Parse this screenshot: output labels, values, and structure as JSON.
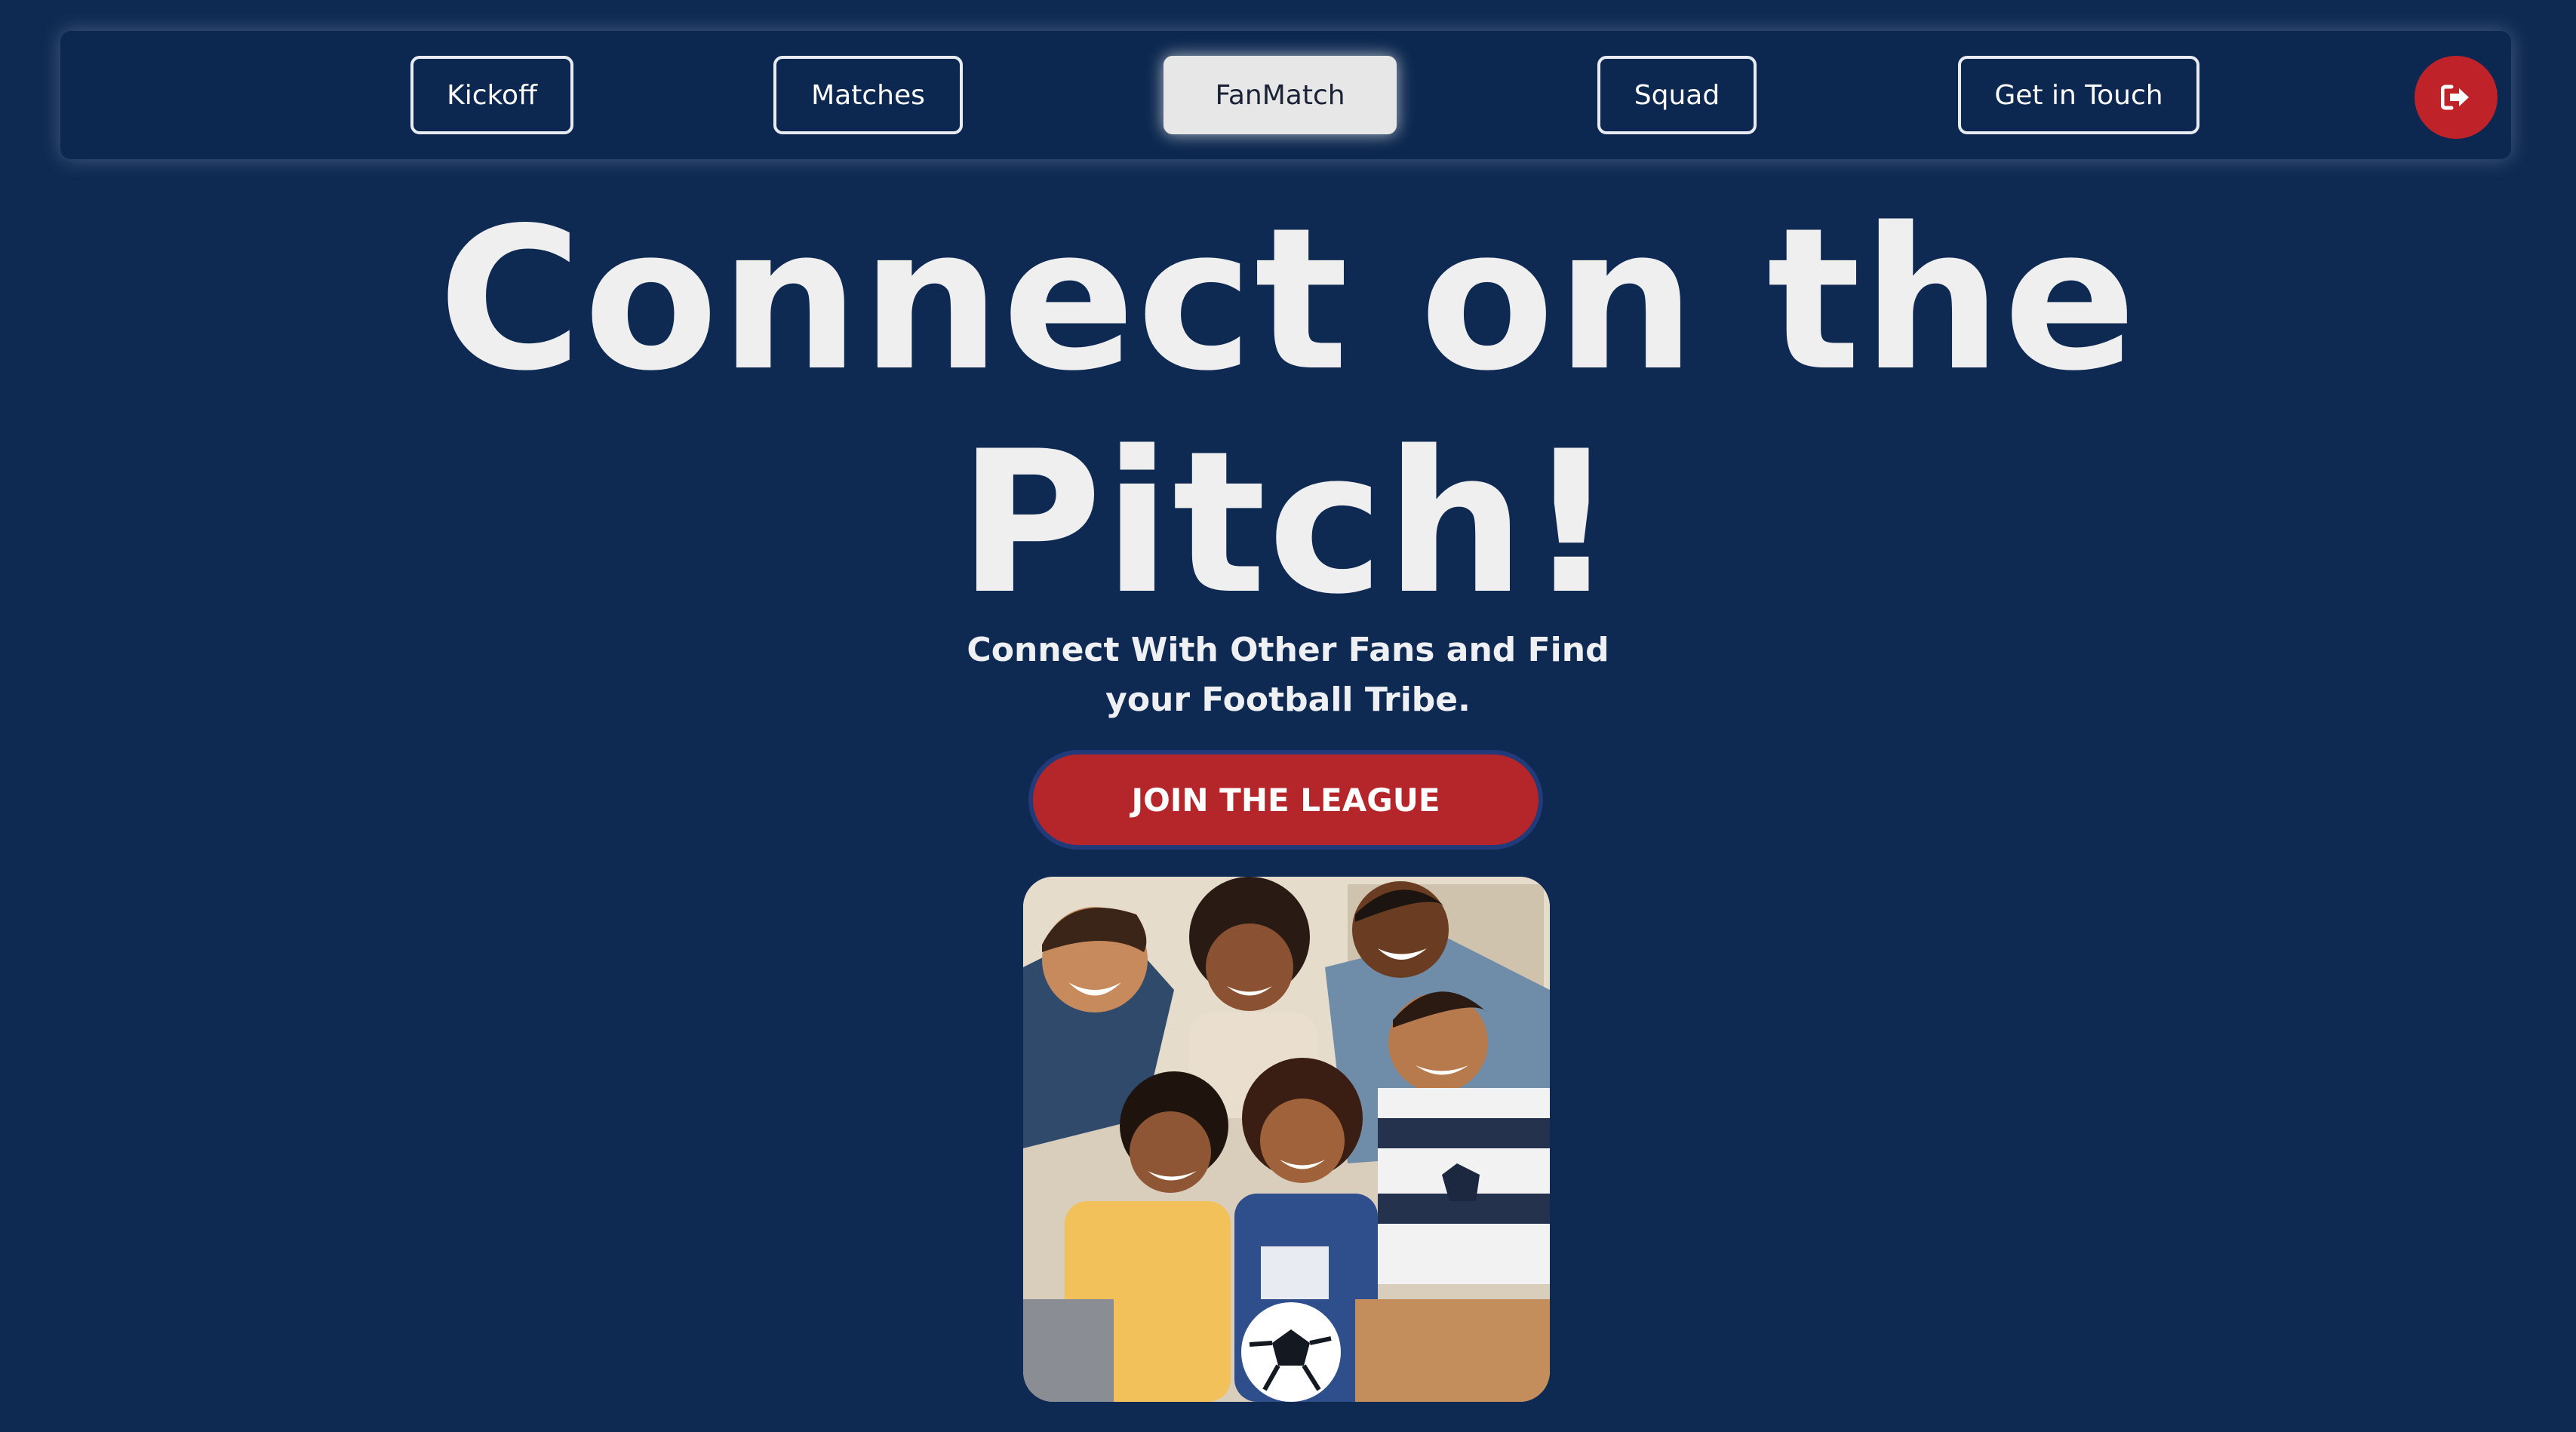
{
  "nav": {
    "items": [
      {
        "label": "Kickoff"
      },
      {
        "label": "Matches"
      },
      {
        "label": "FanMatch",
        "active": true
      },
      {
        "label": "Squad"
      },
      {
        "label": "Get in Touch"
      }
    ],
    "logout_icon": "logout-icon"
  },
  "hero": {
    "headline_line1": "Connect on the",
    "headline_line2": "Pitch!",
    "subtitle_line1": "Connect With Other Fans and Find",
    "subtitle_line2": "your Football Tribe.",
    "cta_label": "JOIN THE LEAGUE",
    "illustration": "fans-celebrating-illustration"
  },
  "colors": {
    "background": "#0f2a52",
    "navbar": "#0c2850",
    "accent_red": "#c0222a",
    "active_tab": "#e7e7e7",
    "text": "#efefef"
  }
}
